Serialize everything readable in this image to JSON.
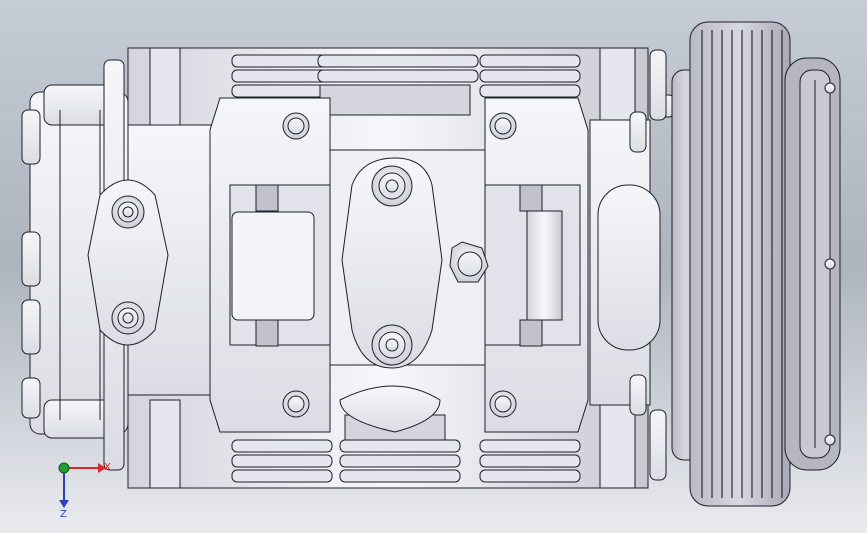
{
  "viewport": {
    "background_colors": [
      "#cdd2da",
      "#a9afb9",
      "#eef0f3"
    ],
    "model_fill": "#f1f1f5",
    "model_shade": "#c9c9d2",
    "edge_color": "#1f1f28"
  },
  "triad": {
    "x_label": "X",
    "z_label": "Z",
    "x_color": "#e0262a",
    "z_color": "#2a3fc8",
    "origin_color": "#20a030"
  }
}
